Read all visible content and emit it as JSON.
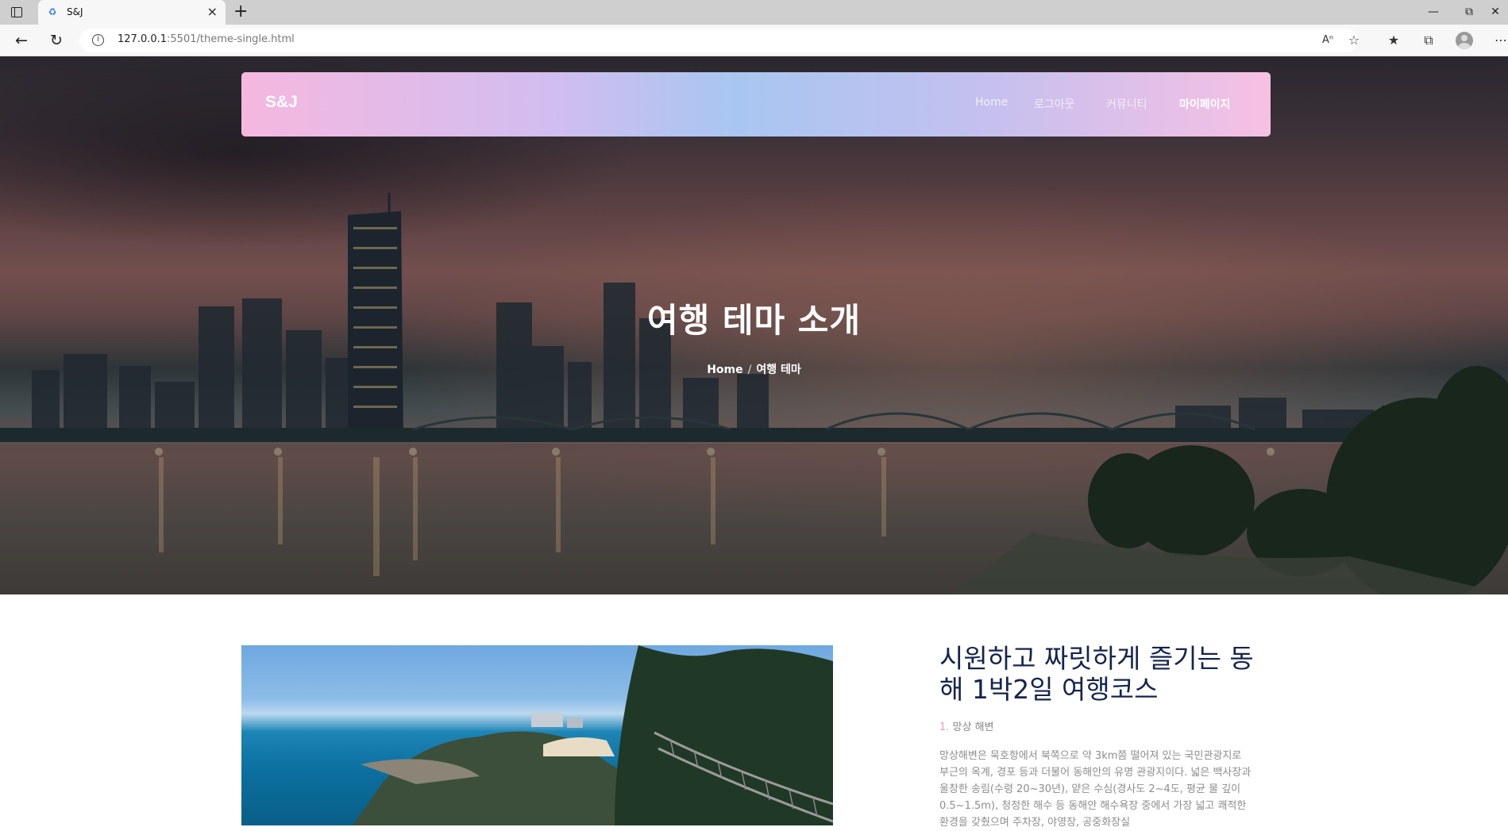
{
  "browser": {
    "tab_title": "S&J",
    "url_host": "127.0.0.1",
    "url_rest": ":5501/theme-single.html"
  },
  "site": {
    "brand": "S&J",
    "nav": [
      {
        "label": "Home"
      },
      {
        "label": "로그아웃"
      },
      {
        "label": "커뮤니티"
      },
      {
        "label": "마이페이지"
      }
    ]
  },
  "hero": {
    "title": "여행 테마 소개",
    "breadcrumb": {
      "home": "Home",
      "separator": "/",
      "current": "여행 테마"
    }
  },
  "article": {
    "title": "시원하고 짜릿하게 즐기는 동해 1박2일 여행코스",
    "item_number": "1.",
    "item_name": "망상 해변",
    "body": "망상해변은 묵호항에서 북쪽으로 약 3km쯤 떨어져 있는 국민관광지로 부근의 옥계, 경포 등과 더불어 동해안의 유명 관광지이다. 넓은 백사장과 울창한 송림(수령 20~30년), 얕은 수심(경사도 2~4도, 평균 물 깊이 0.5~1.5m), 청정한 해수 등 동해안 해수욕장 중에서 가장 넓고 쾌적한 환경을 갖췄으며 주차장, 야영장, 공중화장실"
  },
  "colors": {
    "brand_gradient": [
      "#f5b8df",
      "#a8c6f1",
      "#f7c0e3"
    ],
    "title_navy": "#14244e",
    "body_gray": "#8d8d8d"
  }
}
